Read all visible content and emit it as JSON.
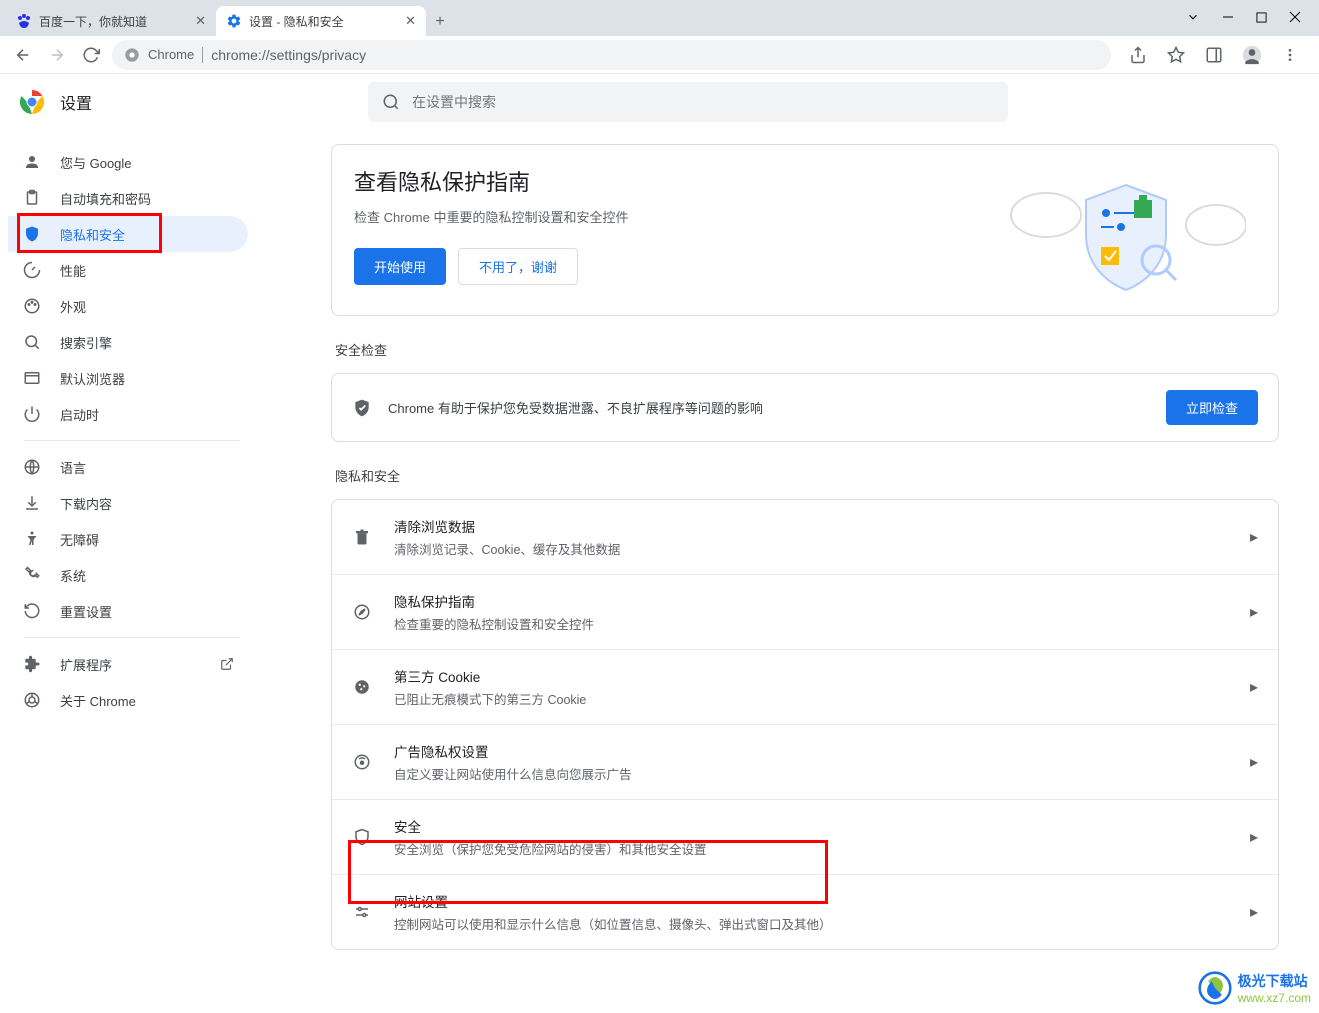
{
  "window": {
    "title_tab1": "百度一下，你就知道",
    "title_tab2": "设置 - 隐私和安全"
  },
  "omnibox": {
    "chrome_label": "Chrome",
    "url": "chrome://settings/privacy"
  },
  "settings": {
    "title": "设置",
    "search_placeholder": "在设置中搜索"
  },
  "sidebar": {
    "items": [
      {
        "label": "您与 Google"
      },
      {
        "label": "自动填充和密码"
      },
      {
        "label": "隐私和安全"
      },
      {
        "label": "性能"
      },
      {
        "label": "外观"
      },
      {
        "label": "搜索引擎"
      },
      {
        "label": "默认浏览器"
      },
      {
        "label": "启动时"
      },
      {
        "label": "语言"
      },
      {
        "label": "下载内容"
      },
      {
        "label": "无障碍"
      },
      {
        "label": "系统"
      },
      {
        "label": "重置设置"
      },
      {
        "label": "扩展程序"
      },
      {
        "label": "关于 Chrome"
      }
    ]
  },
  "guide": {
    "heading": "查看隐私保护指南",
    "desc": "检查 Chrome 中重要的隐私控制设置和安全控件",
    "start": "开始使用",
    "dismiss": "不用了，谢谢"
  },
  "sections": {
    "safety": "安全检查",
    "privacy": "隐私和安全"
  },
  "safety": {
    "text": "Chrome 有助于保护您免受数据泄露、不良扩展程序等问题的影响",
    "button": "立即检查"
  },
  "rows": [
    {
      "title": "清除浏览数据",
      "sub": "清除浏览记录、Cookie、缓存及其他数据"
    },
    {
      "title": "隐私保护指南",
      "sub": "检查重要的隐私控制设置和安全控件"
    },
    {
      "title": "第三方 Cookie",
      "sub": "已阻止无痕模式下的第三方 Cookie"
    },
    {
      "title": "广告隐私权设置",
      "sub": "自定义要让网站使用什么信息向您展示广告"
    },
    {
      "title": "安全",
      "sub": "安全浏览（保护您免受危险网站的侵害）和其他安全设置"
    },
    {
      "title": "网站设置",
      "sub": "控制网站可以使用和显示什么信息（如位置信息、摄像头、弹出式窗口及其他）"
    }
  ],
  "watermark": {
    "cn": "极光下载站",
    "url": "www.xz7.com"
  }
}
